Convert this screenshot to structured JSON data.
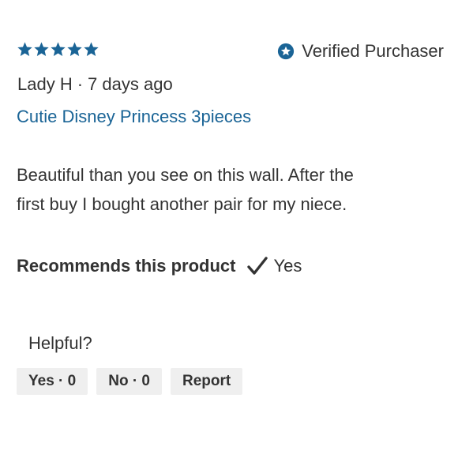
{
  "review": {
    "rating": 5,
    "rating_max": 5,
    "star_color": "#1a6496",
    "verified_icon": "star-badge-icon",
    "verified_label": "Verified Purchaser",
    "author": "Lady H",
    "separator": "·",
    "posted": "7 days ago",
    "title": "Cutie Disney Princess 3pieces",
    "body_line1": "Beautiful than you see on this wall. After the",
    "body_line2": "first buy I bought another pair for my niece.",
    "recommends_label": "Recommends this product",
    "recommends_icon": "checkmark-icon",
    "recommends_value": "Yes"
  },
  "helpful": {
    "label": "Helpful?",
    "yes_label": "Yes · 0",
    "no_label": "No · 0",
    "report_label": "Report"
  }
}
